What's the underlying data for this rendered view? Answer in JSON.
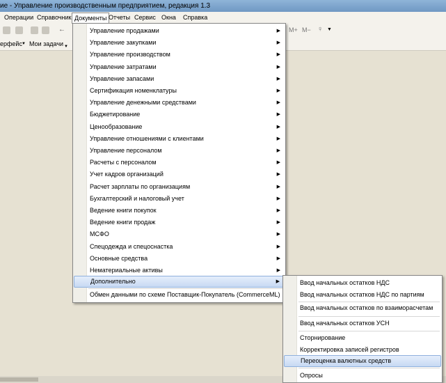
{
  "window": {
    "title": "ие - Управление производственным предприятием, редакция 1.3"
  },
  "menubar": {
    "items": [
      "Операции",
      "Справочники",
      "Документы",
      "Отчеты",
      "Сервис",
      "Окна",
      "Справка"
    ],
    "active": "Документы"
  },
  "toolbar": {
    "memory_plus": "M+",
    "memory_minus": "M−",
    "interface_label": "ерфейс",
    "my_tasks_label": "Мои задачи"
  },
  "documents_menu": [
    "Управление продажами",
    "Управление закупками",
    "Управление производством",
    "Управление затратами",
    "Управление запасами",
    "Сертификация номенклатуры",
    "Управление денежными средствами",
    "Бюджетирование",
    "Ценообразование",
    "Управление отношениями с клиентами",
    "Управление персоналом",
    "Расчеты с персоналом",
    "Учет кадров организаций",
    "Расчет зарплаты по организациям",
    "Бухгалтерский и налоговый учет",
    "Ведение книги покупок",
    "Ведение книги продаж",
    "МСФО",
    "Спецодежда и спецоснастка",
    "Основные средства",
    "Нематериальные активы",
    "Дополнительно",
    "Обмен данными по схеме Поставщик-Покупатель (CommerceML)"
  ],
  "submenu": [
    "Ввод начальных остатков НДС",
    "Ввод начальных остатков НДС по партиям",
    "Ввод начальных остатков по взаиморасчетам",
    "Ввод начальных остатков УСН",
    "Сторнирование",
    "Корректировка записей регистров",
    "Переоценка валютных средств",
    "Опросы"
  ]
}
